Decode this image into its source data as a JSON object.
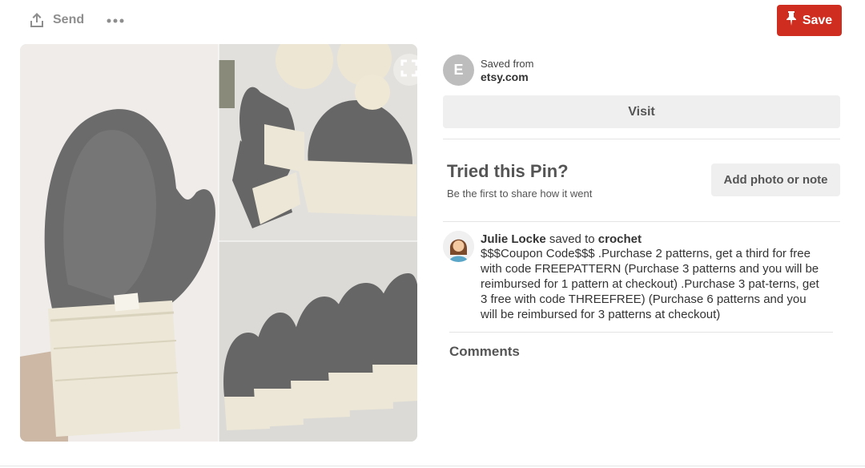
{
  "toolbar": {
    "send_label": "Send",
    "send_icon": "share-upload-icon",
    "more_icon": "ellipsis-icon",
    "save_label": "Save",
    "save_icon": "pushpin-icon",
    "save_color": "#cf2d1f"
  },
  "pin": {
    "image_alt": "Crocheted grey mittens and beanie with cream cuffs",
    "expand_icon": "expand-icon"
  },
  "source": {
    "avatar_letter": "E",
    "label": "Saved from",
    "domain": "etsy.com"
  },
  "visit_label": "Visit",
  "tried": {
    "title": "Tried this Pin?",
    "subtitle": "Be the first to share how it went",
    "add_label": "Add photo or note"
  },
  "activity": {
    "user_name": "Julie Locke",
    "action": "saved to",
    "board": "crochet",
    "description": "$$$Coupon Code$$$ .Purchase 2 patterns, get a third for free with code FREEPATTERN (Purchase 3 patterns and you will be reimbursed for 1 pattern at checkout) .Purchase 3 pat-terns, get 3 free with code THREEFREE) (Purchase 6 patterns and you will be reimbursed for 3 patterns at checkout)"
  },
  "comments_title": "Comments"
}
